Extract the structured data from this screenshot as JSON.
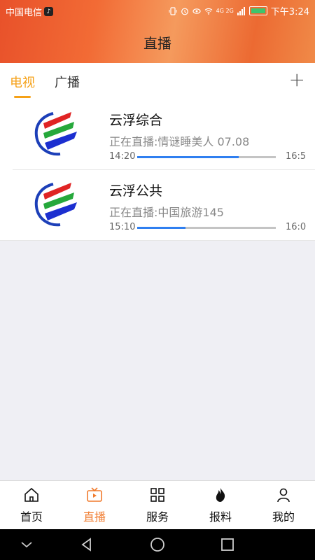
{
  "status": {
    "carrier": "中国电信",
    "time": "下午3:24",
    "network": "4G 2G"
  },
  "header": {
    "title": "直播"
  },
  "tabs": [
    {
      "label": "电视",
      "active": true
    },
    {
      "label": "广播",
      "active": false
    }
  ],
  "channels": [
    {
      "name": "云浮综合",
      "now_playing": "正在直播:情谜睡美人 07.08",
      "start": "14:20",
      "end": "16:5",
      "progress": 0.73
    },
    {
      "name": "云浮公共",
      "now_playing": "正在直播:中国旅游145",
      "start": "15:10",
      "end": "16:0",
      "progress": 0.35
    }
  ],
  "nav": [
    {
      "label": "首页",
      "icon": "home-icon",
      "active": false
    },
    {
      "label": "直播",
      "icon": "tv-icon",
      "active": true
    },
    {
      "label": "服务",
      "icon": "grid-icon",
      "active": false
    },
    {
      "label": "报料",
      "icon": "flame-icon",
      "active": false
    },
    {
      "label": "我的",
      "icon": "user-icon",
      "active": false
    }
  ],
  "colors": {
    "accent": "#f5a118",
    "nav_active": "#f07a2c",
    "progress": "#2f7ff0"
  }
}
